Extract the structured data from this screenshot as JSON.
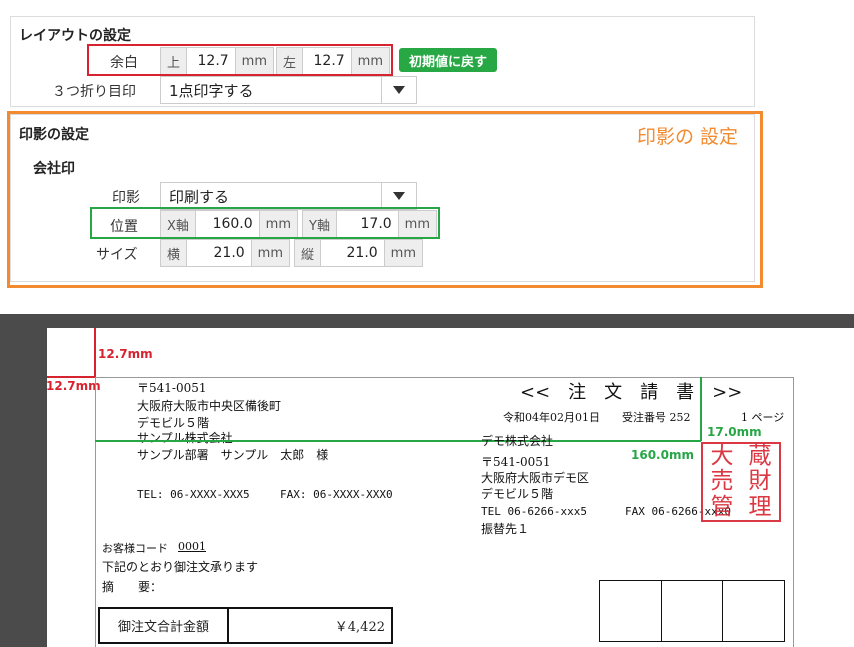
{
  "layout": {
    "heading": "レイアウトの設定",
    "margin_label": "余白",
    "top_label": "上",
    "top_value": "12.7",
    "top_unit": "mm",
    "left_label": "左",
    "left_value": "12.7",
    "left_unit": "mm",
    "reset_button": "初期値に戻す",
    "fold_label": "３つ折り目印",
    "fold_value": "1点印字する"
  },
  "stamp": {
    "heading": "印影の設定",
    "annotation": "印影の 設定",
    "sub_heading": "会社印",
    "print_label": "印影",
    "print_value": "印刷する",
    "position_label": "位置",
    "x_label": "X軸",
    "x_value": "160.0",
    "x_unit": "mm",
    "y_label": "Y軸",
    "y_value": "17.0",
    "y_unit": "mm",
    "size_label": "サイズ",
    "w_label": "横",
    "w_value": "21.0",
    "w_unit": "mm",
    "h_label": "縦",
    "h_value": "21.0",
    "h_unit": "mm"
  },
  "preview": {
    "margin_top_note": "12.7mm",
    "margin_left_note": "12.7mm",
    "y_note": "17.0mm",
    "x_note": "160.0mm",
    "title": "<<　注　文　請　書　>>",
    "date": "令和04年02月01日",
    "order_no": "受注番号 252",
    "page": "1 ページ",
    "postal": "〒541-0051",
    "addr1": "大阪府大阪市中央区備後町",
    "addr2": "デモビル５階",
    "company": "サンプル株式会社",
    "person": "サンプル部署　サンプル　太郎　様",
    "tel": "TEL: 06-XXXX-XXX5",
    "fax": "FAX: 06-XXXX-XXX0",
    "own_company": "デモ株式会社",
    "own_postal": "〒541-0051",
    "own_addr1": "大阪府大阪市デモ区",
    "own_addr2": "デモビル５階",
    "own_tel": "TEL  06-6266-xxx5",
    "own_fax": "FAX  06-6266-xxx0",
    "own_transfer": "振替先１",
    "customer_code_label": "お客様コード",
    "customer_code": "0001",
    "message": "下記のとおり御注文承ります",
    "summary_label": "摘　　要：",
    "total_label": "御注文合計金額",
    "total_value": "￥4,422",
    "seal_chars": [
      "大",
      "蔵",
      "売",
      "財",
      "管",
      "理"
    ]
  },
  "colors": {
    "red": "#d7232f",
    "green": "#27a646",
    "orange": "#f28a30",
    "button_green": "#28a745"
  }
}
